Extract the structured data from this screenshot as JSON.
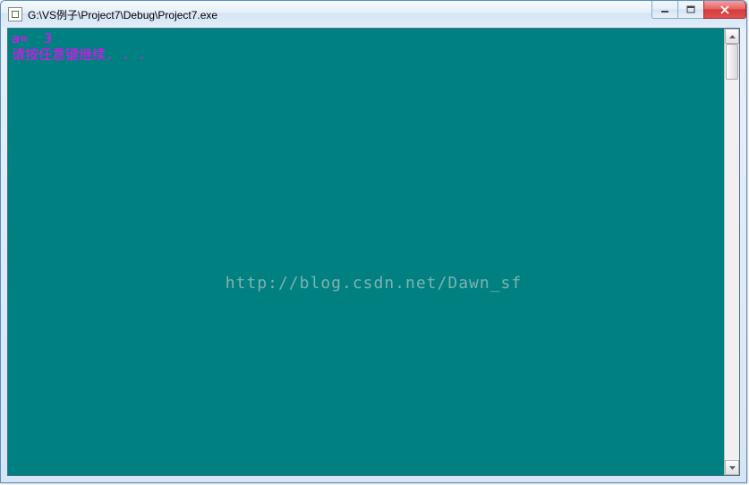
{
  "window": {
    "title": "G:\\VS例子\\Project7\\Debug\\Project7.exe"
  },
  "console": {
    "line1": "a=  3",
    "line2": "请按任意键继续. . ."
  },
  "watermark": {
    "text": "http://blog.csdn.net/Dawn_sf"
  },
  "controls": {
    "minimize_tip": "Minimize",
    "maximize_tip": "Maximize",
    "close_tip": "Close"
  }
}
